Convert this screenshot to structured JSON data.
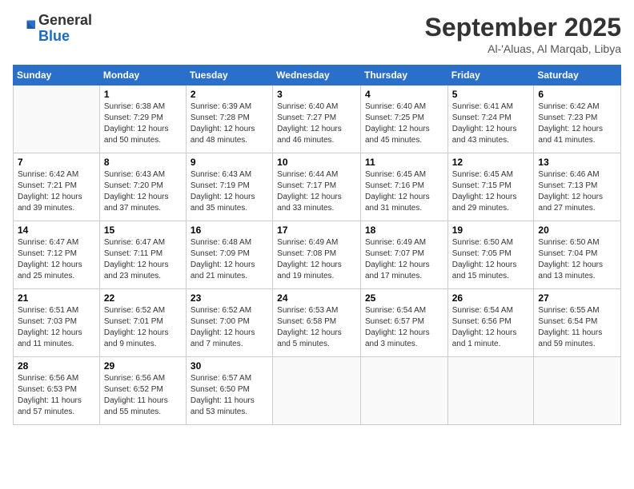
{
  "logo": {
    "general": "General",
    "blue": "Blue"
  },
  "title": "September 2025",
  "subtitle": "Al-'Aluas, Al Marqab, Libya",
  "days_of_week": [
    "Sunday",
    "Monday",
    "Tuesday",
    "Wednesday",
    "Thursday",
    "Friday",
    "Saturday"
  ],
  "weeks": [
    [
      {
        "day": "",
        "info": ""
      },
      {
        "day": "1",
        "info": "Sunrise: 6:38 AM\nSunset: 7:29 PM\nDaylight: 12 hours\nand 50 minutes."
      },
      {
        "day": "2",
        "info": "Sunrise: 6:39 AM\nSunset: 7:28 PM\nDaylight: 12 hours\nand 48 minutes."
      },
      {
        "day": "3",
        "info": "Sunrise: 6:40 AM\nSunset: 7:27 PM\nDaylight: 12 hours\nand 46 minutes."
      },
      {
        "day": "4",
        "info": "Sunrise: 6:40 AM\nSunset: 7:25 PM\nDaylight: 12 hours\nand 45 minutes."
      },
      {
        "day": "5",
        "info": "Sunrise: 6:41 AM\nSunset: 7:24 PM\nDaylight: 12 hours\nand 43 minutes."
      },
      {
        "day": "6",
        "info": "Sunrise: 6:42 AM\nSunset: 7:23 PM\nDaylight: 12 hours\nand 41 minutes."
      }
    ],
    [
      {
        "day": "7",
        "info": "Sunrise: 6:42 AM\nSunset: 7:21 PM\nDaylight: 12 hours\nand 39 minutes."
      },
      {
        "day": "8",
        "info": "Sunrise: 6:43 AM\nSunset: 7:20 PM\nDaylight: 12 hours\nand 37 minutes."
      },
      {
        "day": "9",
        "info": "Sunrise: 6:43 AM\nSunset: 7:19 PM\nDaylight: 12 hours\nand 35 minutes."
      },
      {
        "day": "10",
        "info": "Sunrise: 6:44 AM\nSunset: 7:17 PM\nDaylight: 12 hours\nand 33 minutes."
      },
      {
        "day": "11",
        "info": "Sunrise: 6:45 AM\nSunset: 7:16 PM\nDaylight: 12 hours\nand 31 minutes."
      },
      {
        "day": "12",
        "info": "Sunrise: 6:45 AM\nSunset: 7:15 PM\nDaylight: 12 hours\nand 29 minutes."
      },
      {
        "day": "13",
        "info": "Sunrise: 6:46 AM\nSunset: 7:13 PM\nDaylight: 12 hours\nand 27 minutes."
      }
    ],
    [
      {
        "day": "14",
        "info": "Sunrise: 6:47 AM\nSunset: 7:12 PM\nDaylight: 12 hours\nand 25 minutes."
      },
      {
        "day": "15",
        "info": "Sunrise: 6:47 AM\nSunset: 7:11 PM\nDaylight: 12 hours\nand 23 minutes."
      },
      {
        "day": "16",
        "info": "Sunrise: 6:48 AM\nSunset: 7:09 PM\nDaylight: 12 hours\nand 21 minutes."
      },
      {
        "day": "17",
        "info": "Sunrise: 6:49 AM\nSunset: 7:08 PM\nDaylight: 12 hours\nand 19 minutes."
      },
      {
        "day": "18",
        "info": "Sunrise: 6:49 AM\nSunset: 7:07 PM\nDaylight: 12 hours\nand 17 minutes."
      },
      {
        "day": "19",
        "info": "Sunrise: 6:50 AM\nSunset: 7:05 PM\nDaylight: 12 hours\nand 15 minutes."
      },
      {
        "day": "20",
        "info": "Sunrise: 6:50 AM\nSunset: 7:04 PM\nDaylight: 12 hours\nand 13 minutes."
      }
    ],
    [
      {
        "day": "21",
        "info": "Sunrise: 6:51 AM\nSunset: 7:03 PM\nDaylight: 12 hours\nand 11 minutes."
      },
      {
        "day": "22",
        "info": "Sunrise: 6:52 AM\nSunset: 7:01 PM\nDaylight: 12 hours\nand 9 minutes."
      },
      {
        "day": "23",
        "info": "Sunrise: 6:52 AM\nSunset: 7:00 PM\nDaylight: 12 hours\nand 7 minutes."
      },
      {
        "day": "24",
        "info": "Sunrise: 6:53 AM\nSunset: 6:58 PM\nDaylight: 12 hours\nand 5 minutes."
      },
      {
        "day": "25",
        "info": "Sunrise: 6:54 AM\nSunset: 6:57 PM\nDaylight: 12 hours\nand 3 minutes."
      },
      {
        "day": "26",
        "info": "Sunrise: 6:54 AM\nSunset: 6:56 PM\nDaylight: 12 hours\nand 1 minute."
      },
      {
        "day": "27",
        "info": "Sunrise: 6:55 AM\nSunset: 6:54 PM\nDaylight: 11 hours\nand 59 minutes."
      }
    ],
    [
      {
        "day": "28",
        "info": "Sunrise: 6:56 AM\nSunset: 6:53 PM\nDaylight: 11 hours\nand 57 minutes."
      },
      {
        "day": "29",
        "info": "Sunrise: 6:56 AM\nSunset: 6:52 PM\nDaylight: 11 hours\nand 55 minutes."
      },
      {
        "day": "30",
        "info": "Sunrise: 6:57 AM\nSunset: 6:50 PM\nDaylight: 11 hours\nand 53 minutes."
      },
      {
        "day": "",
        "info": ""
      },
      {
        "day": "",
        "info": ""
      },
      {
        "day": "",
        "info": ""
      },
      {
        "day": "",
        "info": ""
      }
    ]
  ]
}
